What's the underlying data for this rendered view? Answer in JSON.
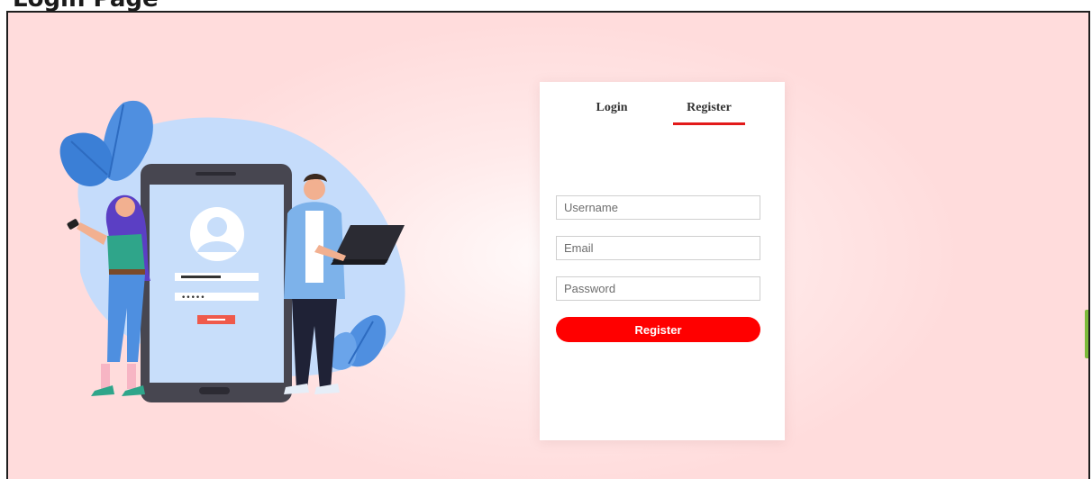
{
  "page": {
    "header_text_partial": "Login Page"
  },
  "auth": {
    "tabs": [
      {
        "label": "Login",
        "active": false
      },
      {
        "label": "Register",
        "active": true
      }
    ],
    "fields": {
      "username": {
        "placeholder": "Username",
        "value": ""
      },
      "email": {
        "placeholder": "Email",
        "value": ""
      },
      "password": {
        "placeholder": "Password",
        "value": ""
      }
    },
    "submit_label": "Register"
  },
  "illustration": {
    "password_mask": "•••••"
  },
  "colors": {
    "accent": "#ff0000",
    "active_tab_underline": "#e21a1a",
    "background": "#ffe3e3",
    "blob": "#c5dcfb",
    "leaf": "#4f8fe0",
    "phone": "#474650",
    "side_tab": "#7dbb3a"
  }
}
